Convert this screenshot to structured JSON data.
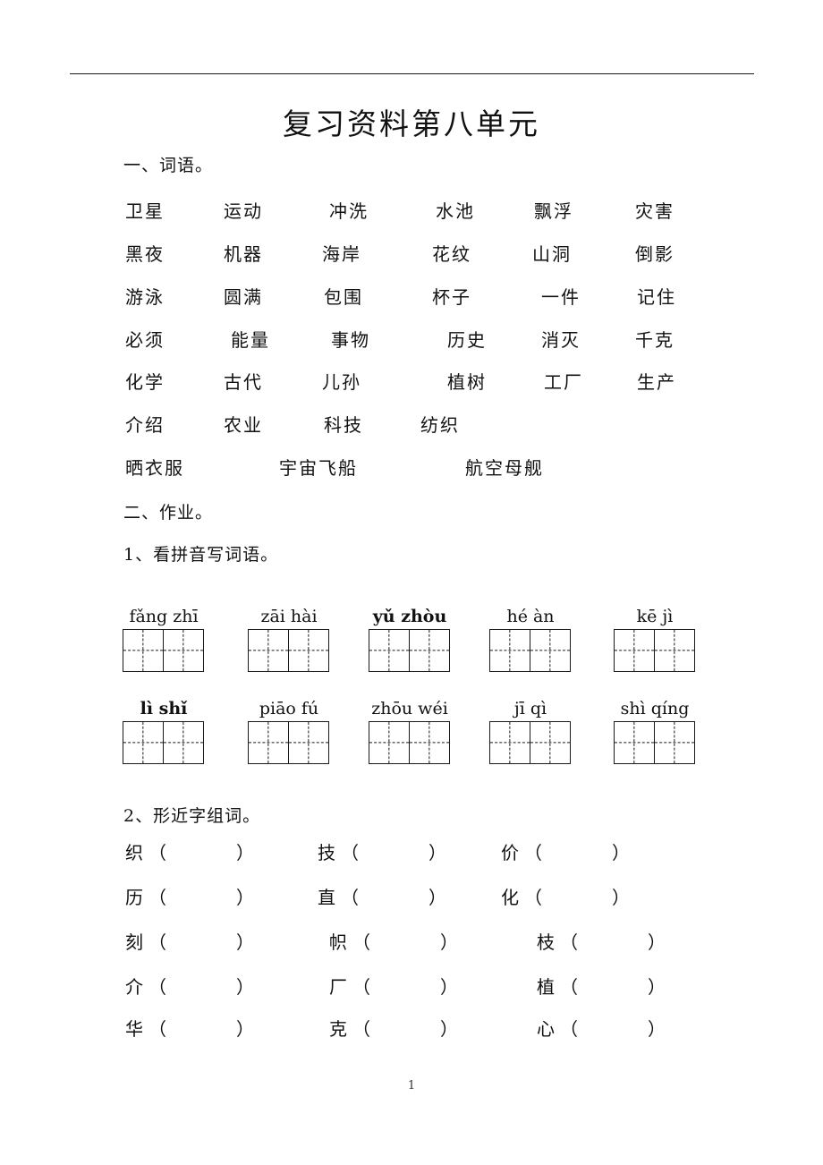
{
  "document": {
    "title": "复习资料第八单元",
    "page_number": "1"
  },
  "section_one": {
    "heading": "一、词语。",
    "word_rows": [
      [
        "卫星",
        "运动",
        "冲洗",
        "水池",
        "飘浮",
        "灾害"
      ],
      [
        "黑夜",
        "机器",
        "海岸",
        "花纹",
        "山洞",
        "倒影"
      ],
      [
        "游泳",
        "圆满",
        "包围",
        "杯子",
        "一件",
        "记住"
      ],
      [
        "必须",
        "能量",
        "事物",
        "历史",
        "消灭",
        "千克"
      ],
      [
        "化学",
        "古代",
        "儿孙",
        "植树",
        "工厂",
        "生产"
      ],
      [
        "介绍",
        "农业",
        "科技",
        "纺织"
      ],
      [
        "晒衣服",
        "宇宙飞船",
        "航空母舰"
      ]
    ]
  },
  "section_two": {
    "heading": "二、作业。",
    "task_one": {
      "heading": "1、看拼音写词语。",
      "pinyin_rows": [
        [
          {
            "syllables": "fǎng zhī",
            "bold": false
          },
          {
            "syllables": "zāi hài",
            "bold": false
          },
          {
            "syllables": "yǔ zhòu",
            "bold": true
          },
          {
            "syllables": "hé  àn",
            "bold": false
          },
          {
            "syllables": "kē  jì",
            "bold": false
          }
        ],
        [
          {
            "syllables": "lì  shǐ",
            "bold": true
          },
          {
            "syllables": "piāo fú",
            "bold": false
          },
          {
            "syllables": "zhōu wéi",
            "bold": false
          },
          {
            "syllables": "jī  qì",
            "bold": false
          },
          {
            "syllables": "shì qíng",
            "bold": false
          }
        ]
      ]
    },
    "task_two": {
      "heading": "2、形近字组词。",
      "rows": [
        [
          "织",
          "技",
          "价"
        ],
        [
          "历",
          "直",
          "化"
        ],
        [
          "刻",
          "帜",
          "枝"
        ],
        [
          "介",
          "厂",
          "植"
        ],
        [
          "华",
          "克",
          "心"
        ]
      ]
    }
  }
}
